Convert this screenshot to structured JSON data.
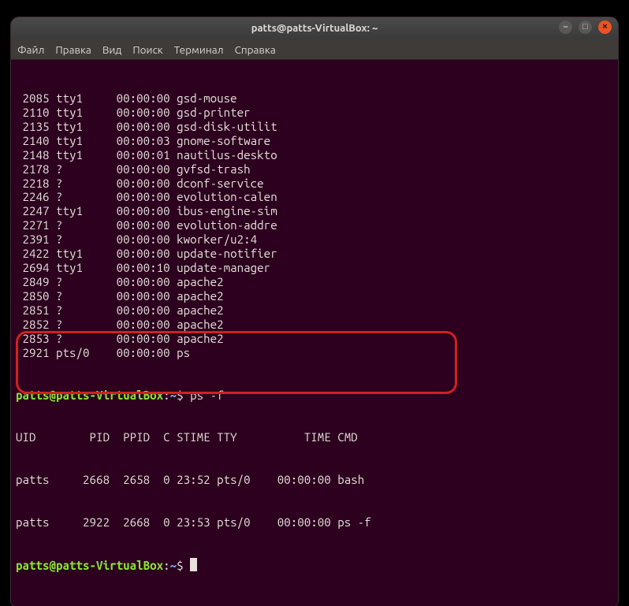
{
  "titlebar": {
    "title": "patts@patts-VirtualBox: ~"
  },
  "window_controls": {
    "minimize_glyph": "–",
    "maximize_glyph": "□",
    "close_glyph": "×"
  },
  "menubar": {
    "file": "Файл",
    "edit": "Правка",
    "view": "Вид",
    "search": "Поиск",
    "terminal": "Терминал",
    "help": "Справка"
  },
  "ps_rows": [
    {
      "pid": " 2085",
      "tty": "tty1 ",
      "time": "00:00:00",
      "cmd": "gsd-mouse"
    },
    {
      "pid": " 2110",
      "tty": "tty1 ",
      "time": "00:00:00",
      "cmd": "gsd-printer"
    },
    {
      "pid": " 2135",
      "tty": "tty1 ",
      "time": "00:00:00",
      "cmd": "gsd-disk-utilit"
    },
    {
      "pid": " 2140",
      "tty": "tty1 ",
      "time": "00:00:03",
      "cmd": "gnome-software"
    },
    {
      "pid": " 2148",
      "tty": "tty1 ",
      "time": "00:00:01",
      "cmd": "nautilus-deskto"
    },
    {
      "pid": " 2178",
      "tty": "?    ",
      "time": "00:00:00",
      "cmd": "gvfsd-trash"
    },
    {
      "pid": " 2218",
      "tty": "?    ",
      "time": "00:00:00",
      "cmd": "dconf-service"
    },
    {
      "pid": " 2246",
      "tty": "?    ",
      "time": "00:00:00",
      "cmd": "evolution-calen"
    },
    {
      "pid": " 2247",
      "tty": "tty1 ",
      "time": "00:00:00",
      "cmd": "ibus-engine-sim"
    },
    {
      "pid": " 2271",
      "tty": "?    ",
      "time": "00:00:00",
      "cmd": "evolution-addre"
    },
    {
      "pid": " 2391",
      "tty": "?    ",
      "time": "00:00:00",
      "cmd": "kworker/u2:4"
    },
    {
      "pid": " 2422",
      "tty": "tty1 ",
      "time": "00:00:00",
      "cmd": "update-notifier"
    },
    {
      "pid": " 2694",
      "tty": "tty1 ",
      "time": "00:00:10",
      "cmd": "update-manager"
    },
    {
      "pid": " 2849",
      "tty": "?    ",
      "time": "00:00:00",
      "cmd": "apache2"
    },
    {
      "pid": " 2850",
      "tty": "?    ",
      "time": "00:00:00",
      "cmd": "apache2"
    },
    {
      "pid": " 2851",
      "tty": "?    ",
      "time": "00:00:00",
      "cmd": "apache2"
    },
    {
      "pid": " 2852",
      "tty": "?    ",
      "time": "00:00:00",
      "cmd": "apache2"
    },
    {
      "pid": " 2853",
      "tty": "?    ",
      "time": "00:00:00",
      "cmd": "apache2"
    },
    {
      "pid": " 2921",
      "tty": "pts/0",
      "time": "00:00:00",
      "cmd": "ps"
    }
  ],
  "prompt1": {
    "user": "patts@patts-VirtualBox",
    "colon": ":",
    "path": "~",
    "dollar": "$ ",
    "command": "ps -f"
  },
  "psf_header": "UID        PID  PPID  C STIME TTY          TIME CMD",
  "psf_rows": [
    "patts     2668  2658  0 23:52 pts/0    00:00:00 bash",
    "patts     2922  2668  0 23:53 pts/0    00:00:00 ps -f"
  ],
  "prompt2": {
    "user": "patts@patts-VirtualBox",
    "colon": ":",
    "path": "~",
    "dollar": "$ "
  },
  "colors": {
    "bg": "#2c001e",
    "fg": "#e6e1dc",
    "promptUser": "#8ae234",
    "promptPath": "#729fcf",
    "highlight": "#d02121"
  }
}
